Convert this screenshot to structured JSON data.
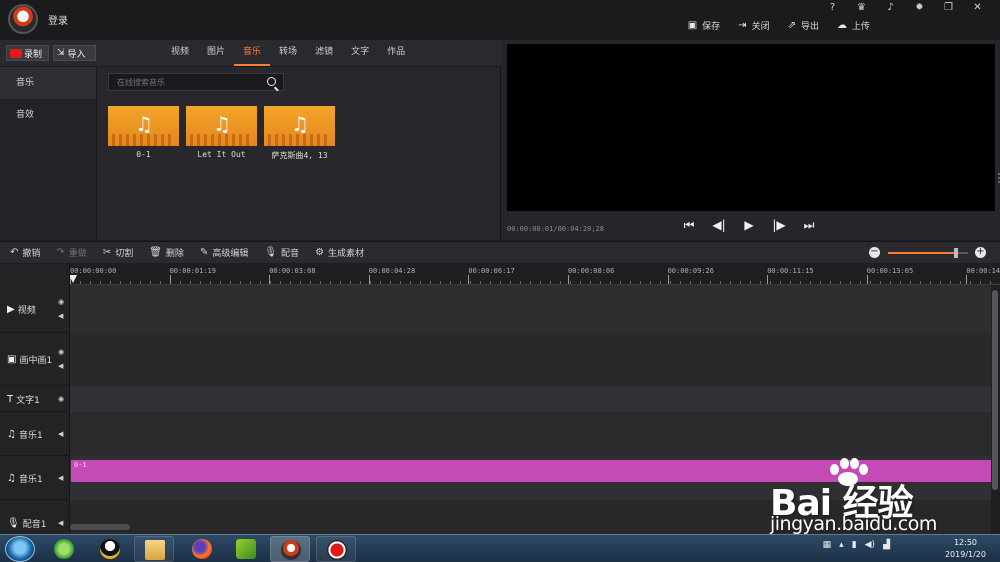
{
  "titlebar": {
    "login_label": "登录",
    "window_controls": [
      "?",
      "VIP",
      "bell",
      "gear",
      "maximize",
      "close"
    ],
    "actions": [
      {
        "icon": "save-icon",
        "label": "保存"
      },
      {
        "icon": "exit-icon",
        "label": "关闭"
      },
      {
        "icon": "export-icon",
        "label": "导出"
      },
      {
        "icon": "upload-icon",
        "label": "上传"
      }
    ]
  },
  "library": {
    "record_label": "录制",
    "import_label": "导入",
    "tabs": [
      "视频",
      "图片",
      "音乐",
      "转场",
      "滤镜",
      "文字",
      "作品"
    ],
    "active_tab": "音乐",
    "categories": [
      "音乐",
      "音效"
    ],
    "search_placeholder": "在线搜索音乐",
    "items": [
      {
        "caption": "0-1"
      },
      {
        "caption": "Let It Out"
      },
      {
        "caption": "萨克斯曲4, 13"
      }
    ]
  },
  "preview": {
    "timecode": "00:00:00:01/00:04:20;28"
  },
  "timeline_toolbar": {
    "buttons": [
      {
        "icon": "undo-icon",
        "label": "撤销",
        "enabled": true
      },
      {
        "icon": "redo-icon",
        "label": "重做",
        "enabled": false
      },
      {
        "icon": "cut-icon",
        "label": "切割",
        "enabled": true
      },
      {
        "icon": "delete-icon",
        "label": "删除",
        "enabled": true
      },
      {
        "icon": "edit-icon",
        "label": "高级编辑",
        "enabled": true
      },
      {
        "icon": "mic-icon",
        "label": "配音",
        "enabled": true
      },
      {
        "icon": "generate-icon",
        "label": "生成素材",
        "enabled": true
      }
    ],
    "zoom_level": 0.85,
    "accent_color": "#ff7b2e"
  },
  "ruler": {
    "ticks": [
      "00:00:00:00",
      "00:00:01:19",
      "00:00:03:08",
      "00:00:04:28",
      "00:00:06:17",
      "00:00:08:06",
      "00:00:09:26",
      "00:00:11:15",
      "00:00:13:05",
      "00:00:14:"
    ]
  },
  "tracks": [
    {
      "icon": "video-track-icon",
      "label": "视频"
    },
    {
      "icon": "pip-track-icon",
      "label": "画中画1"
    },
    {
      "icon": "text-track-icon",
      "label": "文字1"
    },
    {
      "icon": "music-track-icon",
      "label": "音乐1"
    },
    {
      "icon": "music-track-icon",
      "label": "音乐1"
    },
    {
      "icon": "mic-track-icon",
      "label": "配音1"
    }
  ],
  "clip": {
    "label": "0-1",
    "color": "#c44ab6"
  },
  "watermark": {
    "brand": "Bai  经验",
    "url": "jingyan.baidu.com"
  },
  "taskbar": {
    "time": "12:50",
    "date": "2019/1/20"
  }
}
